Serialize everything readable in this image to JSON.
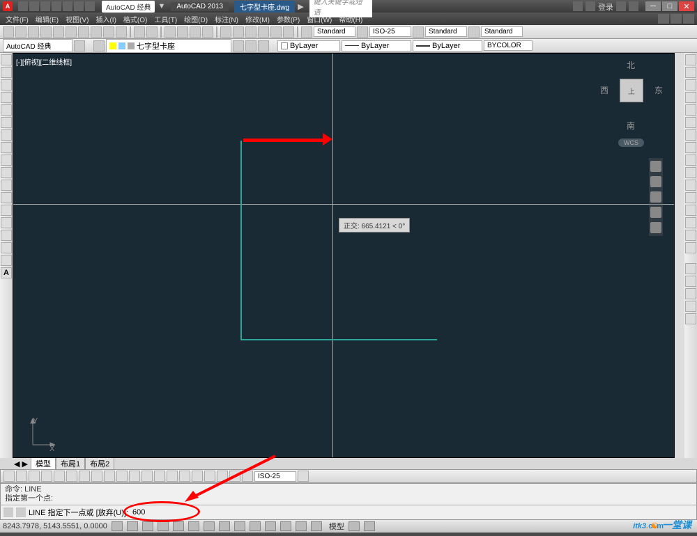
{
  "titlebar": {
    "logo": "A",
    "workspace": "AutoCAD 经典",
    "app": "AutoCAD 2013",
    "doc": "七字型卡座.dwg",
    "search_placeholder": "键入关键字或短语",
    "login": "登录"
  },
  "menus": [
    "文件(F)",
    "编辑(E)",
    "视图(V)",
    "插入(I)",
    "格式(O)",
    "工具(T)",
    "绘图(D)",
    "标注(N)",
    "修改(M)",
    "参数(P)",
    "窗口(W)",
    "帮助(H)"
  ],
  "styles": {
    "text_style": "Standard",
    "dim_style": "ISO-25",
    "table_style": "Standard",
    "mleader_style": "Standard"
  },
  "layers": {
    "workspace": "AutoCAD 经典",
    "current": "七字型卡座",
    "bylayer1": "ByLayer",
    "bylayer2": "ByLayer",
    "bylayer3": "ByLayer",
    "bycolor": "BYCOLOR"
  },
  "viewport": {
    "label": "[-][俯视][二维线框]"
  },
  "viewcube": {
    "top": "上",
    "n": "北",
    "s": "南",
    "e": "东",
    "w": "西",
    "wcs": "WCS"
  },
  "tooltip": "正交: 665.4121 < 0°",
  "tabs": [
    "模型",
    "布局1",
    "布局2"
  ],
  "dim_toolbar": {
    "style": "ISO-25"
  },
  "command": {
    "hist1": "命令: LINE",
    "hist2": "指定第一个点:",
    "prompt": "LINE 指定下一点或 [放弃(U)]:",
    "input": "600"
  },
  "status": {
    "coords": "8243.7978, 5143.5551, 0.0000",
    "model": "模型"
  },
  "ucs": {
    "x": "X",
    "y": "Y"
  },
  "watermark": {
    "main": "itk3",
    "dot": ".",
    "com": "com",
    "cn": "一堂课"
  }
}
